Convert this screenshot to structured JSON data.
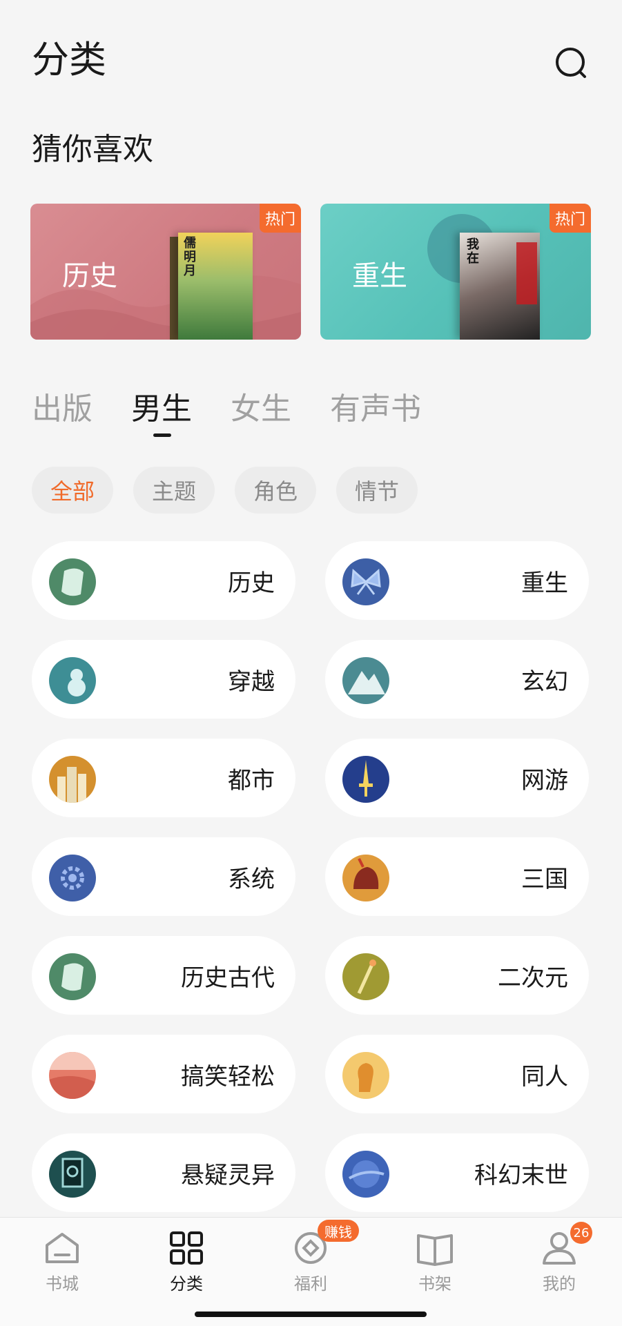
{
  "header": {
    "title": "分类"
  },
  "section": {
    "title": "猜你喜欢"
  },
  "featured": [
    {
      "label": "历史",
      "badge": "热门",
      "cover_text": "儒明月"
    },
    {
      "label": "重生",
      "badge": "热门",
      "cover_text": "我在"
    }
  ],
  "tabs": [
    {
      "label": "出版"
    },
    {
      "label": "男生",
      "active": true
    },
    {
      "label": "女生"
    },
    {
      "label": "有声书"
    }
  ],
  "filters": [
    {
      "label": "全部",
      "active": true
    },
    {
      "label": "主题"
    },
    {
      "label": "角色"
    },
    {
      "label": "情节"
    }
  ],
  "categories": [
    {
      "name": "历史",
      "icon": "scroll-icon",
      "color": "#4f8a68"
    },
    {
      "name": "重生",
      "icon": "butterfly-icon",
      "color": "#3d5fa6"
    },
    {
      "name": "穿越",
      "icon": "gourd-icon",
      "color": "#3e8e95"
    },
    {
      "name": "玄幻",
      "icon": "mountain-icon",
      "color": "#4b8b92"
    },
    {
      "name": "都市",
      "icon": "city-icon",
      "color": "#d4902e"
    },
    {
      "name": "网游",
      "icon": "sword-icon",
      "color": "#243e8c"
    },
    {
      "name": "系统",
      "icon": "gear-icon",
      "color": "#3f5fa8"
    },
    {
      "name": "三国",
      "icon": "helmet-icon",
      "color": "#e09b3b"
    },
    {
      "name": "历史古代",
      "icon": "scroll-icon",
      "color": "#4f8a68"
    },
    {
      "name": "二次元",
      "icon": "brush-icon",
      "color": "#a09a33"
    },
    {
      "name": "搞笑轻松",
      "icon": "smile-icon",
      "color": "#e57b68"
    },
    {
      "name": "同人",
      "icon": "head-icon",
      "color": "#f4c96e"
    },
    {
      "name": "悬疑灵异",
      "icon": "mystery-card-icon",
      "color": "#1e4f4f"
    },
    {
      "name": "科幻末世",
      "icon": "planet-icon",
      "color": "#3e64b8"
    }
  ],
  "bottom_nav": [
    {
      "label": "书城",
      "icon": "home-icon"
    },
    {
      "label": "分类",
      "icon": "grid-icon",
      "active": true
    },
    {
      "label": "福利",
      "icon": "coin-icon",
      "badge": "赚钱"
    },
    {
      "label": "书架",
      "icon": "book-icon"
    },
    {
      "label": "我的",
      "icon": "user-icon",
      "badge": "26"
    }
  ],
  "colors": {
    "accent": "#f46b2e",
    "active_filter": "#f06a2a",
    "background": "#f5f5f5"
  }
}
